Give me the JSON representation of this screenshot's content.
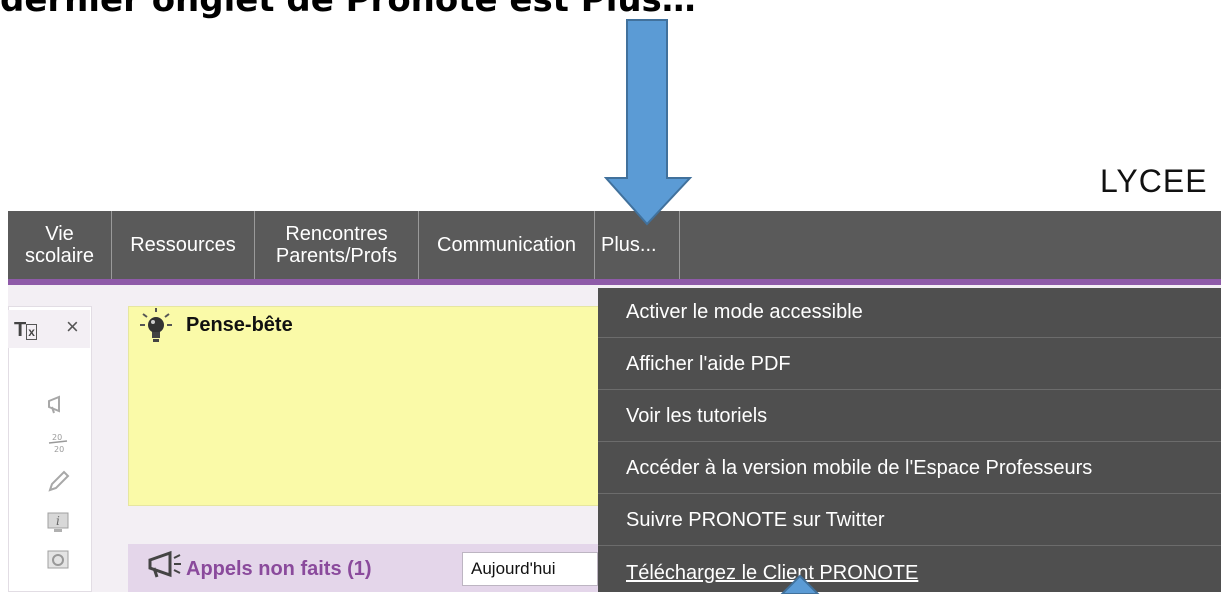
{
  "slide": {
    "title": "dernier onglet de Pronote est Plus…",
    "school_label": "LYCEE"
  },
  "navbar": {
    "tabs": [
      {
        "label": "Vie\nscolaire"
      },
      {
        "label": "Ressources"
      },
      {
        "label": "Rencontres\nParents/Profs"
      },
      {
        "label": "Communication"
      },
      {
        "label": "Plus..."
      }
    ]
  },
  "dropdown_menu": {
    "items": [
      {
        "label": "Activer le mode accessible"
      },
      {
        "label": "Afficher l'aide PDF"
      },
      {
        "label": "Voir les tutoriels"
      },
      {
        "label": "Accéder à la version mobile de l'Espace Professeurs"
      },
      {
        "label": "Suivre PRONOTE sur Twitter"
      },
      {
        "label": "Téléchargez le Client PRONOTE"
      }
    ]
  },
  "pense_bete": {
    "title": "Pense-bête"
  },
  "appels": {
    "title": "Appels non faits (1)",
    "date_value": "Aujourd'hui"
  },
  "colors": {
    "navbar_bg": "#5a5a5a",
    "accent_purple": "#8e5aa8",
    "menu_bg": "#4f4f4f",
    "note_yellow": "#fafaa8",
    "arrow_blue": "#5b9bd5"
  },
  "icons": [
    "lightbulb-icon",
    "megaphone-icon",
    "clear-format-icon",
    "close-icon",
    "grade-icon",
    "pencil-icon",
    "info-icon",
    "clock-icon"
  ]
}
